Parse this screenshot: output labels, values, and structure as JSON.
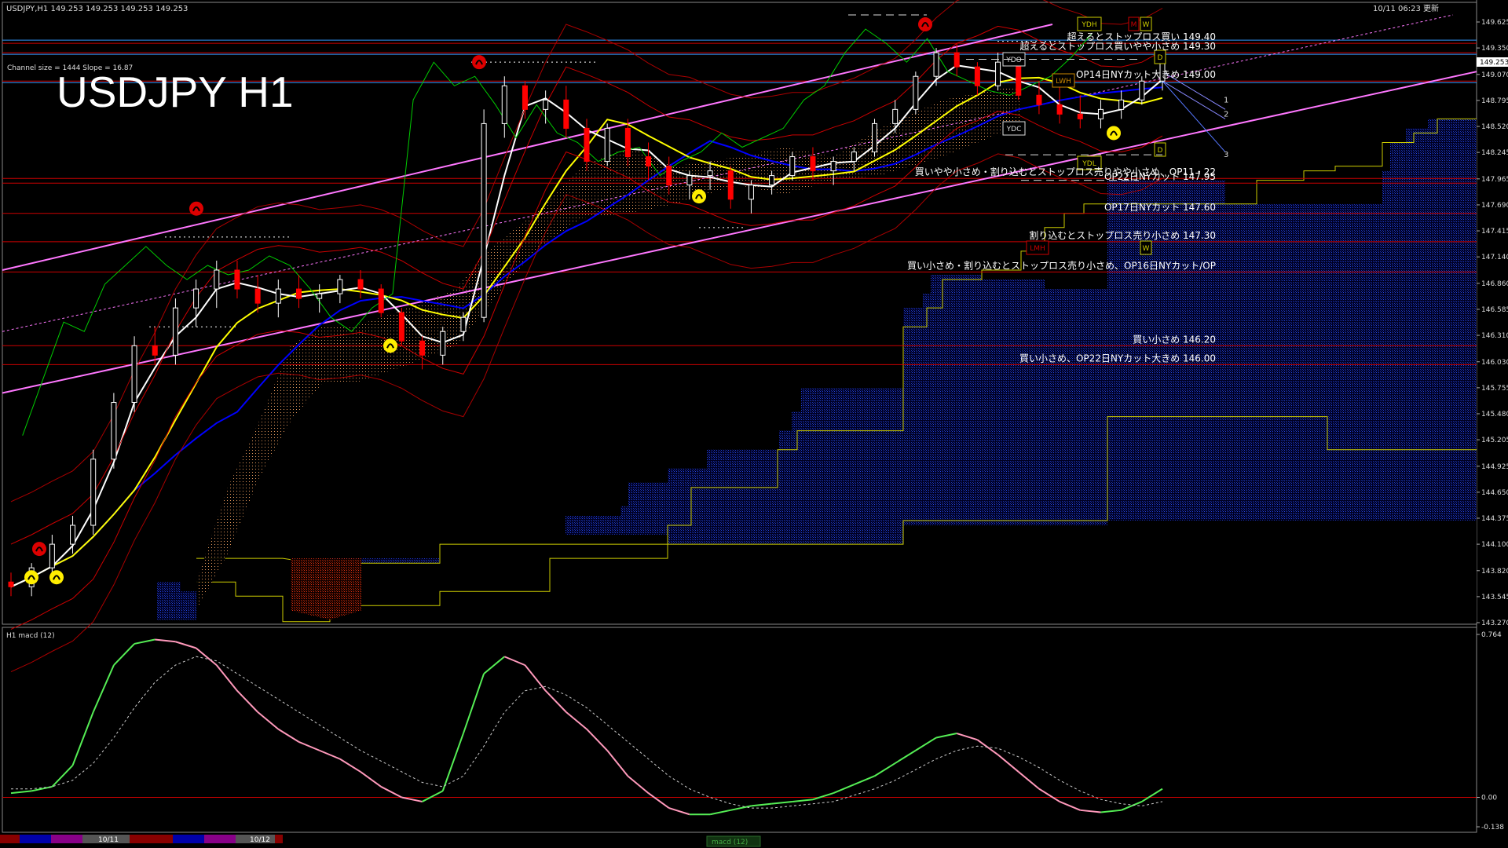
{
  "window": {
    "header_info": "USDJPY,H1  149.253 149.253 149.253 149.253",
    "header_time": "10/11 06:23 更新",
    "symbol_title": "USDJPY H1",
    "channel_info": "Channel size = 1444 Slope = 16.87",
    "price_tag": "149.253"
  },
  "price_axis": {
    "labels": [
      "149.625",
      "149.350",
      "149.070",
      "148.795",
      "148.520",
      "148.245",
      "147.965",
      "147.690",
      "147.415",
      "147.140",
      "146.860",
      "146.585",
      "146.310",
      "146.030",
      "145.755",
      "145.480",
      "145.205",
      "144.925",
      "144.650",
      "144.375",
      "144.100",
      "143.820",
      "143.545",
      "143.270"
    ],
    "ylim": [
      143.27,
      149.625
    ]
  },
  "macd_panel": {
    "title": "H1 macd (12)",
    "labels": [
      "0.764",
      "0.00",
      "-0.138"
    ],
    "ylim": [
      -0.138,
      0.764
    ]
  },
  "bottom_bar": {
    "dates": [
      "10/11",
      "10/12"
    ],
    "macd_tab": "macd (12)"
  },
  "annotations": [
    {
      "label": "超えるとストップロス買い 149.40",
      "price": 149.4
    },
    {
      "label": "超えるとストップロス買いやや小さめ 149.30",
      "price": 149.3
    },
    {
      "label": "OP14日NYカット大きめ 149.00",
      "price": 149.0
    },
    {
      "label": "買いやや小さめ・割り込むとストップロス売りやや小さめ、OP11・22",
      "price": 147.97
    },
    {
      "label": "OP22日NYカット 147.95",
      "price": 147.92
    },
    {
      "label": "OP17日NYカット 147.60",
      "price": 147.6
    },
    {
      "label": "割り込むとストップロス売り小さめ 147.30",
      "price": 147.3
    },
    {
      "label": "買い小さめ・割り込むとストップロス売り小さめ、OP16日NYカット/OP",
      "price": 146.98
    },
    {
      "label": "買い小さめ 146.20",
      "price": 146.2
    },
    {
      "label": "買い小さめ、OP22日NYカット大きめ 146.00",
      "price": 146.0
    }
  ],
  "level_boxes": [
    "YDH",
    "YDO",
    "YDC",
    "YDL",
    "LWH",
    "LMH",
    "M",
    "W",
    "D",
    "W",
    "D"
  ],
  "projection_labels": [
    "1",
    "2",
    "3"
  ],
  "colors": {
    "background": "#000000",
    "bull": "#ffffff",
    "bear": "#ff0000",
    "sma_fast": "#ffffff",
    "sma_mid": "#ffff00",
    "sma_slow": "#0000ff",
    "channel": "#ff77ff",
    "bollinger": "#cc0000",
    "chikou": "#00cc00",
    "kumo_bull": "#ffaa55",
    "kumo_bear": "#3355ff",
    "macd_up": "#55ee55",
    "macd_down": "#ff99bb",
    "signal": "#cccccc",
    "levels": "#cc0000",
    "hline_blue": "#3399ff"
  },
  "chart_data": {
    "type": "candlestick",
    "title": "USDJPY H1",
    "xlabel": "",
    "ylabel": "",
    "ylim": [
      143.27,
      149.625
    ],
    "x_dates": [
      "10/11",
      "10/12"
    ],
    "ohlc_estimate": [
      [
        143.7,
        143.8,
        143.55,
        143.65
      ],
      [
        143.65,
        143.9,
        143.55,
        143.85
      ],
      [
        143.85,
        144.2,
        143.8,
        144.1
      ],
      [
        144.1,
        144.4,
        144.0,
        144.3
      ],
      [
        144.3,
        145.1,
        144.2,
        145.0
      ],
      [
        145.0,
        145.7,
        144.9,
        145.6
      ],
      [
        145.6,
        146.3,
        145.5,
        146.2
      ],
      [
        146.2,
        146.4,
        146.0,
        146.1
      ],
      [
        146.1,
        146.7,
        146.0,
        146.6
      ],
      [
        146.6,
        146.9,
        146.4,
        146.8
      ],
      [
        146.8,
        147.1,
        146.6,
        147.0
      ],
      [
        147.0,
        147.1,
        146.7,
        146.8
      ],
      [
        146.8,
        146.95,
        146.55,
        146.65
      ],
      [
        146.65,
        146.9,
        146.5,
        146.8
      ],
      [
        146.8,
        146.95,
        146.6,
        146.7
      ],
      [
        146.7,
        146.85,
        146.55,
        146.75
      ],
      [
        146.75,
        146.95,
        146.65,
        146.9
      ],
      [
        146.9,
        147.0,
        146.7,
        146.8
      ],
      [
        146.8,
        146.85,
        146.5,
        146.55
      ],
      [
        146.55,
        146.6,
        146.2,
        146.25
      ],
      [
        146.25,
        146.3,
        145.95,
        146.1
      ],
      [
        146.1,
        146.4,
        146.0,
        146.35
      ],
      [
        146.35,
        146.55,
        146.25,
        146.5
      ],
      [
        146.5,
        148.7,
        146.45,
        148.55
      ],
      [
        148.55,
        149.05,
        148.4,
        148.95
      ],
      [
        148.95,
        149.0,
        148.6,
        148.7
      ],
      [
        148.7,
        148.9,
        148.55,
        148.8
      ],
      [
        148.8,
        148.95,
        148.4,
        148.5
      ],
      [
        148.5,
        148.6,
        148.05,
        148.15
      ],
      [
        148.15,
        148.55,
        148.1,
        148.5
      ],
      [
        148.5,
        148.6,
        148.1,
        148.2
      ],
      [
        148.2,
        148.35,
        147.95,
        148.1
      ],
      [
        148.1,
        148.2,
        147.8,
        147.9
      ],
      [
        147.9,
        148.05,
        147.75,
        148.0
      ],
      [
        148.0,
        148.15,
        147.85,
        148.05
      ],
      [
        148.05,
        148.1,
        147.65,
        147.75
      ],
      [
        147.75,
        147.95,
        147.6,
        147.9
      ],
      [
        147.9,
        148.05,
        147.8,
        148.0
      ],
      [
        148.0,
        148.25,
        147.95,
        148.2
      ],
      [
        148.2,
        148.3,
        147.95,
        148.05
      ],
      [
        148.05,
        148.2,
        147.9,
        148.15
      ],
      [
        148.15,
        148.3,
        148.05,
        148.25
      ],
      [
        148.25,
        148.6,
        148.2,
        148.55
      ],
      [
        148.55,
        148.8,
        148.45,
        148.7
      ],
      [
        148.7,
        149.1,
        148.65,
        149.05
      ],
      [
        149.05,
        149.35,
        148.95,
        149.3
      ],
      [
        149.3,
        149.4,
        149.05,
        149.15
      ],
      [
        149.15,
        149.2,
        148.85,
        148.95
      ],
      [
        148.95,
        149.3,
        148.9,
        149.2
      ],
      [
        149.2,
        149.25,
        148.8,
        148.85
      ],
      [
        148.85,
        149.0,
        148.65,
        148.75
      ],
      [
        148.75,
        148.95,
        148.55,
        148.65
      ],
      [
        148.65,
        148.85,
        148.5,
        148.6
      ],
      [
        148.6,
        148.8,
        148.5,
        148.7
      ],
      [
        148.7,
        148.9,
        148.6,
        148.8
      ],
      [
        148.8,
        149.05,
        148.75,
        149.0
      ],
      [
        149.0,
        149.3,
        148.9,
        149.25
      ]
    ],
    "series": [
      {
        "name": "macd (12)",
        "type": "line",
        "role": "macd"
      },
      {
        "name": "signal",
        "type": "dotted",
        "role": "signal"
      }
    ],
    "horizontal_levels": [
      149.4,
      149.3,
      149.0,
      147.97,
      147.92,
      147.6,
      147.3,
      146.98,
      146.2,
      146.0
    ],
    "grid": false
  }
}
